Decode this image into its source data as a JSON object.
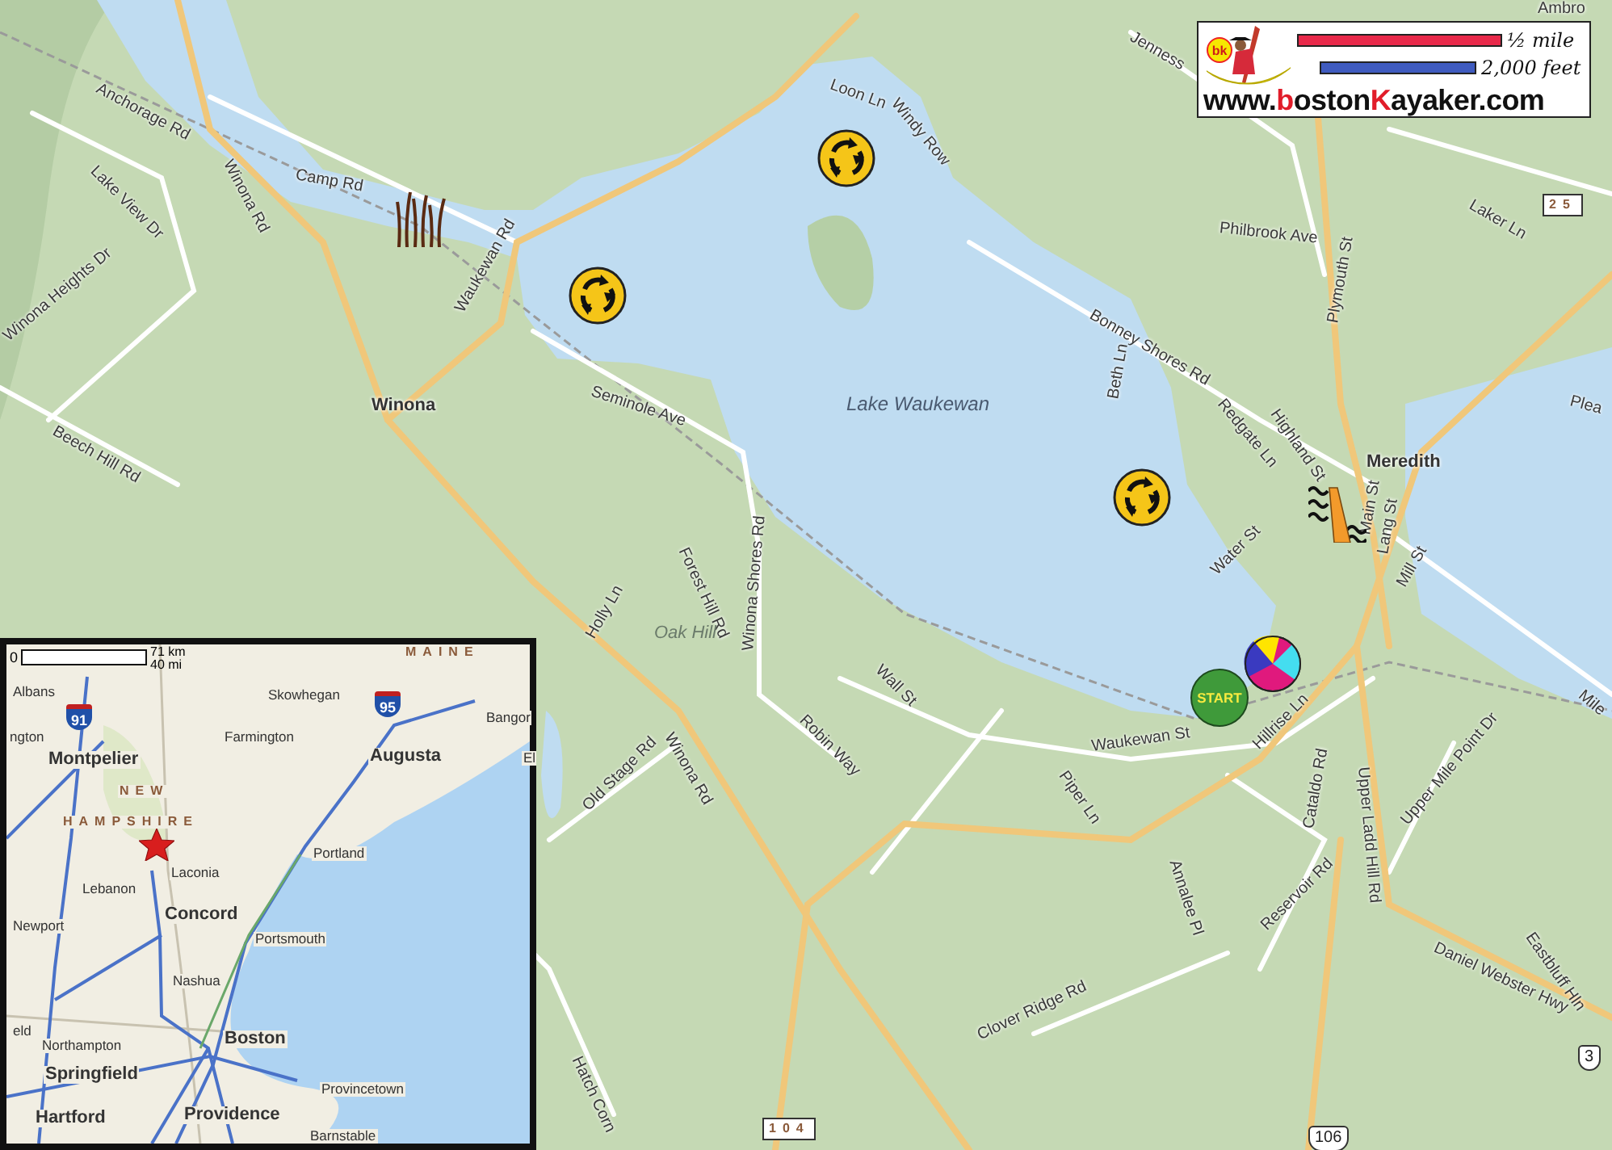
{
  "map": {
    "labels": [
      {
        "text": "Anchorage Rd",
        "kind": "road"
      },
      {
        "text": "Winona Rd",
        "kind": "road"
      },
      {
        "text": "Camp Rd",
        "kind": "road"
      },
      {
        "text": "Lake View Dr",
        "kind": "road"
      },
      {
        "text": "Winona Heights Dr",
        "kind": "road"
      },
      {
        "text": "Beech Hill Rd",
        "kind": "road"
      },
      {
        "text": "Waukewan Rd",
        "kind": "road"
      },
      {
        "text": "Winona",
        "kind": "town"
      },
      {
        "text": "Seminole Ave",
        "kind": "road"
      },
      {
        "text": "Loon Ln",
        "kind": "road"
      },
      {
        "text": "Windy Row",
        "kind": "road"
      },
      {
        "text": "Jenness",
        "kind": "road"
      },
      {
        "text": "Ambro",
        "kind": "road"
      },
      {
        "text": "Lake Waukewan",
        "kind": "lake"
      },
      {
        "text": "Philbrook Ave",
        "kind": "road"
      },
      {
        "text": "Laker Ln",
        "kind": "road"
      },
      {
        "text": "Plymouth St",
        "kind": "road"
      },
      {
        "text": "Bonney Shores Rd",
        "kind": "road"
      },
      {
        "text": "Beth Ln",
        "kind": "road"
      },
      {
        "text": "Redgate Ln",
        "kind": "road"
      },
      {
        "text": "Highland St",
        "kind": "road"
      },
      {
        "text": "Plea",
        "kind": "road"
      },
      {
        "text": "Meredith",
        "kind": "town"
      },
      {
        "text": "Main St",
        "kind": "road"
      },
      {
        "text": "Lang St",
        "kind": "road"
      },
      {
        "text": "Water St",
        "kind": "road"
      },
      {
        "text": "Mill St",
        "kind": "road"
      },
      {
        "text": "Forest Hill Rd",
        "kind": "road"
      },
      {
        "text": "Holly Ln",
        "kind": "road"
      },
      {
        "text": "Oak Hill",
        "kind": "hill"
      },
      {
        "text": "Winona Shores Rd",
        "kind": "road"
      },
      {
        "text": "Robin Way",
        "kind": "road"
      },
      {
        "text": "Wall St",
        "kind": "road"
      },
      {
        "text": "Waukewan St",
        "kind": "road"
      },
      {
        "text": "Piper Ln",
        "kind": "road"
      },
      {
        "text": "Hillrise Ln",
        "kind": "road"
      },
      {
        "text": "Mile",
        "kind": "road"
      },
      {
        "text": "Winona Rd",
        "kind": "road"
      },
      {
        "text": "Old Stage Rd",
        "kind": "road"
      },
      {
        "text": "Cataldo Rd",
        "kind": "road"
      },
      {
        "text": "Upper Ladd Hill Rd",
        "kind": "road"
      },
      {
        "text": "Upper Mile Point Dr",
        "kind": "road"
      },
      {
        "text": "Annalee Pl",
        "kind": "road"
      },
      {
        "text": "Reservoir Rd",
        "kind": "road"
      },
      {
        "text": "Daniel Webster Hwy",
        "kind": "road"
      },
      {
        "text": "Eastbluff Hln",
        "kind": "road"
      },
      {
        "text": "Clover Ridge Rd",
        "kind": "road"
      },
      {
        "text": "Hatch Corn",
        "kind": "road"
      }
    ],
    "route_shields": [
      {
        "number": "25",
        "kind": "state"
      },
      {
        "number": "3",
        "kind": "us"
      },
      {
        "number": "104",
        "kind": "state"
      },
      {
        "number": "106",
        "kind": "us"
      }
    ],
    "markers": [
      {
        "kind": "reeds"
      },
      {
        "kind": "roundabout"
      },
      {
        "kind": "roundabout"
      },
      {
        "kind": "roundabout"
      },
      {
        "kind": "rapids"
      },
      {
        "kind": "beach-ball"
      },
      {
        "kind": "start",
        "label": "START"
      }
    ]
  },
  "legend": {
    "logo_text": "bk",
    "scale_bars": [
      {
        "label": "½ mile",
        "color": "#e8294a"
      },
      {
        "label": "2,000 feet",
        "color": "#3f5bbf"
      }
    ],
    "website_parts": [
      "www.",
      "b",
      "oston",
      "K",
      "ayaker.com"
    ]
  },
  "inset_map": {
    "scale": {
      "zero": "0",
      "km": "71 km",
      "mi": "40 mi"
    },
    "interstate_shields": [
      "91",
      "95"
    ],
    "labels": [
      {
        "text": "MAINE",
        "kind": "state"
      },
      {
        "text": "Albans",
        "kind": "place"
      },
      {
        "text": "Skowhegan",
        "kind": "place"
      },
      {
        "text": "Bangor",
        "kind": "place"
      },
      {
        "text": "ngton",
        "kind": "place"
      },
      {
        "text": "Farmington",
        "kind": "place"
      },
      {
        "text": "Montpelier",
        "kind": "city"
      },
      {
        "text": "Augusta",
        "kind": "city"
      },
      {
        "text": "El",
        "kind": "place"
      },
      {
        "text": "NEW",
        "kind": "state"
      },
      {
        "text": "HAMPSHIRE",
        "kind": "state"
      },
      {
        "text": "Portland",
        "kind": "place"
      },
      {
        "text": "Laconia",
        "kind": "place"
      },
      {
        "text": "Lebanon",
        "kind": "place"
      },
      {
        "text": "Concord",
        "kind": "city"
      },
      {
        "text": "Newport",
        "kind": "place"
      },
      {
        "text": "Portsmouth",
        "kind": "place"
      },
      {
        "text": "Nashua",
        "kind": "place"
      },
      {
        "text": "eld",
        "kind": "place"
      },
      {
        "text": "Boston",
        "kind": "city"
      },
      {
        "text": "Northampton",
        "kind": "place"
      },
      {
        "text": "Springfield",
        "kind": "city"
      },
      {
        "text": "Provincetown",
        "kind": "place"
      },
      {
        "text": "Hartford",
        "kind": "city"
      },
      {
        "text": "Providence",
        "kind": "city"
      },
      {
        "text": "Barnstable",
        "kind": "place"
      }
    ]
  }
}
